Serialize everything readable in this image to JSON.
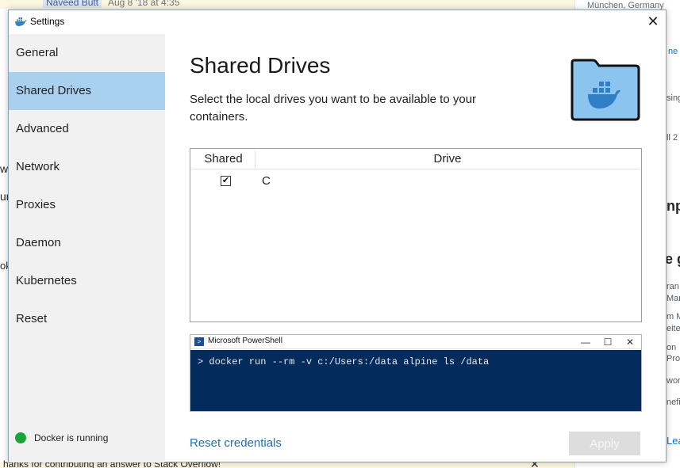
{
  "background": {
    "user": "Naveed Butt",
    "date": "Aug 8 '18 at 4:35",
    "city": "München, Germany",
    "fragments_right": [
      "ne",
      "sing",
      "ll 2",
      "np",
      "e g",
      "ran",
      "Mar",
      "m M",
      "eiter",
      "on",
      "Pro",
      "wor",
      "nefi",
      "Lea"
    ],
    "fragments_left": [
      "w",
      "ur",
      "ok"
    ],
    "bottom_text": "hanks for contributing an answer to Stack Overflow!"
  },
  "window": {
    "title": "Settings",
    "close_glyph": "✕"
  },
  "sidebar": {
    "items": [
      {
        "label": "General"
      },
      {
        "label": "Shared Drives"
      },
      {
        "label": "Advanced"
      },
      {
        "label": "Network"
      },
      {
        "label": "Proxies"
      },
      {
        "label": "Daemon"
      },
      {
        "label": "Kubernetes"
      },
      {
        "label": "Reset"
      }
    ],
    "active_index": 1,
    "status": "Docker is running",
    "status_color": "#1aa53a"
  },
  "main": {
    "title": "Shared Drives",
    "description": "Select the local drives you want to be available to your containers.",
    "table": {
      "headers": {
        "shared": "Shared",
        "drive": "Drive"
      },
      "rows": [
        {
          "shared": true,
          "drive": "C"
        }
      ]
    },
    "powershell": {
      "title": "Microsoft PowerShell",
      "command": "> docker run --rm -v c:/Users:/data alpine ls /data",
      "bg_color": "#032b5c"
    },
    "reset_label": "Reset credentials",
    "apply_label": "Apply",
    "accent_color": "#2271b3"
  }
}
